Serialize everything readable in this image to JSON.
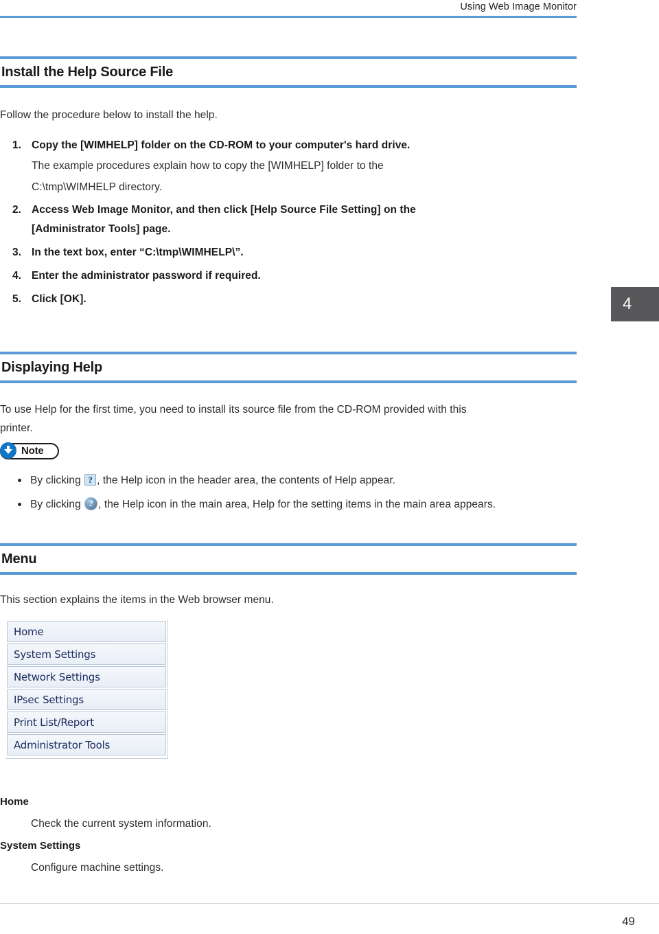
{
  "header": {
    "running_title": "Using Web Image Monitor",
    "rule_color": "#5b9bd5"
  },
  "chapter_tab": {
    "number": "4",
    "background": "#58575a",
    "text_color": "#ffffff"
  },
  "sections": [
    {
      "title": "Install the Help Source File",
      "intro": "Follow the procedure below to install the help.",
      "steps": [
        {
          "num": "1.",
          "title": "Copy the [WIMHELP] folder on the CD-ROM to your computer's hard drive.",
          "body_lines": [
            "The example procedures explain how to copy the [WIMHELP] folder to the",
            "C:\\tmp\\WIMHELP directory."
          ]
        },
        {
          "num": "2.",
          "title_line1": "Access Web Image Monitor, and then click [Help Source File Setting] on the",
          "title_line2": "[Administrator Tools] page.",
          "body_lines": []
        },
        {
          "num": "3.",
          "title": "In the text box, enter “C:\\tmp\\WIMHELP\\”.",
          "body_lines": []
        },
        {
          "num": "4.",
          "title": "Enter the administrator password if required.",
          "body_lines": []
        },
        {
          "num": "5.",
          "title": "Click [OK].",
          "body_lines": []
        }
      ]
    },
    {
      "title": "Displaying Help",
      "intro_line1": "To use Help for the first time, you need to install its source file from the CD-ROM provided with this",
      "intro_line2": "printer."
    },
    {
      "title": "Menu",
      "intro": "This section explains the items in the Web browser menu."
    }
  ],
  "note": {
    "label": "Note",
    "icon": "down-arrow-circle-icon",
    "icon_color": "#1076c4",
    "bullets": [
      {
        "text_before": "By clicking ",
        "icon": "help-question-square-icon",
        "icon_glyph": "?",
        "text_after": ", the Help icon in the header area, the contents of Help appear."
      },
      {
        "text_before": "By clicking ",
        "icon": "help-question-round-icon",
        "icon_glyph": "?",
        "text_after": ", the Help icon in the main area, Help for the setting items in the main area appears."
      }
    ]
  },
  "menu_screenshot": {
    "items": [
      "Home",
      "System Settings",
      "Network Settings",
      "IPsec Settings",
      "Print List/Report",
      "Administrator Tools"
    ],
    "text_color": "#1a2a5e"
  },
  "definitions": [
    {
      "term": "Home",
      "desc": "Check the current system information."
    },
    {
      "term": "System Settings",
      "desc": "Configure machine settings."
    }
  ],
  "footer": {
    "page_number": "49"
  }
}
